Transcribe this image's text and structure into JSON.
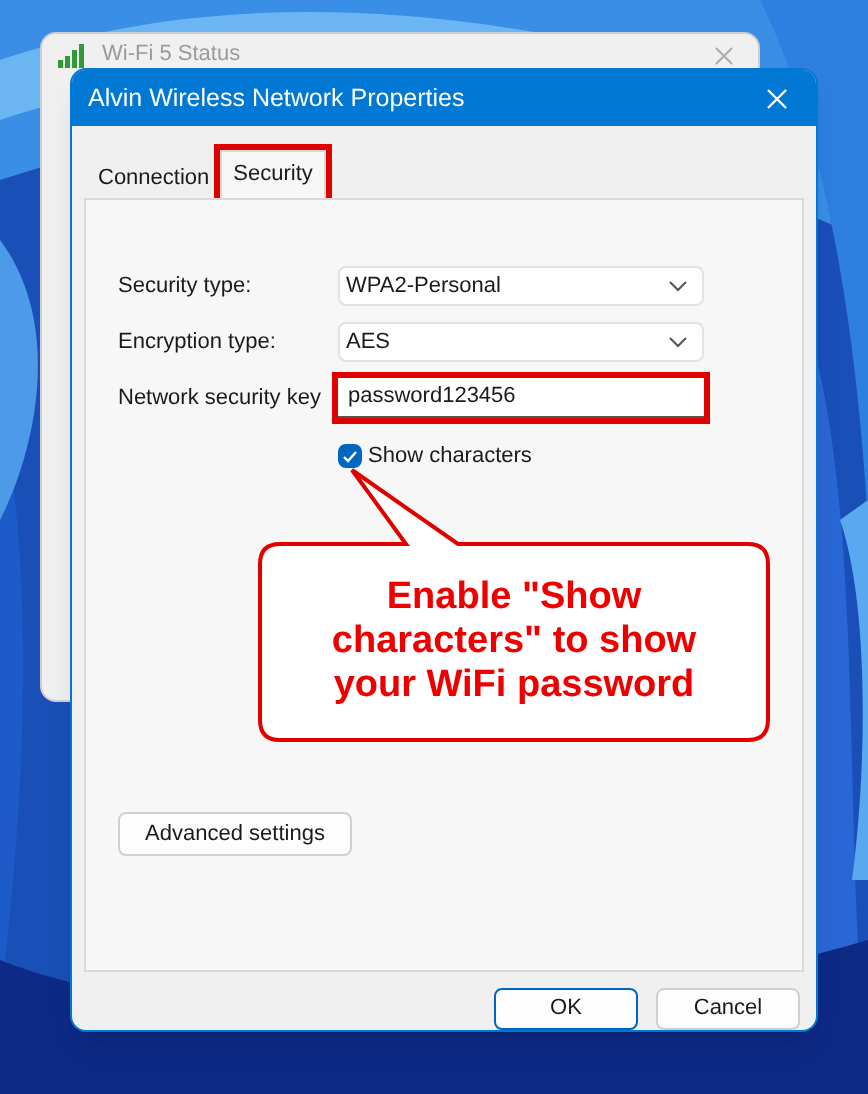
{
  "background_window": {
    "title": "Wi-Fi 5 Status"
  },
  "dialog": {
    "title": "Alvin Wireless Network Properties"
  },
  "tabs": [
    {
      "label": "Connection",
      "selected": false,
      "highlighted": false
    },
    {
      "label": "Security",
      "selected": true,
      "highlighted": true
    }
  ],
  "fields": [
    {
      "kind": "dropdown",
      "label": "Security type:",
      "value": "WPA2-Personal",
      "highlighted": false
    },
    {
      "kind": "dropdown",
      "label": "Encryption type:",
      "value": "AES",
      "highlighted": false
    },
    {
      "kind": "text",
      "label": "Network security key",
      "value": "password123456",
      "highlighted": true
    }
  ],
  "show_characters": {
    "label": "Show characters",
    "checked": true
  },
  "callout": {
    "text": "Enable \"Show characters\" to show your WiFi password"
  },
  "advanced_button": "Advanced settings",
  "buttons": [
    {
      "label": "OK",
      "default": true
    },
    {
      "label": "Cancel",
      "default": false
    }
  ]
}
